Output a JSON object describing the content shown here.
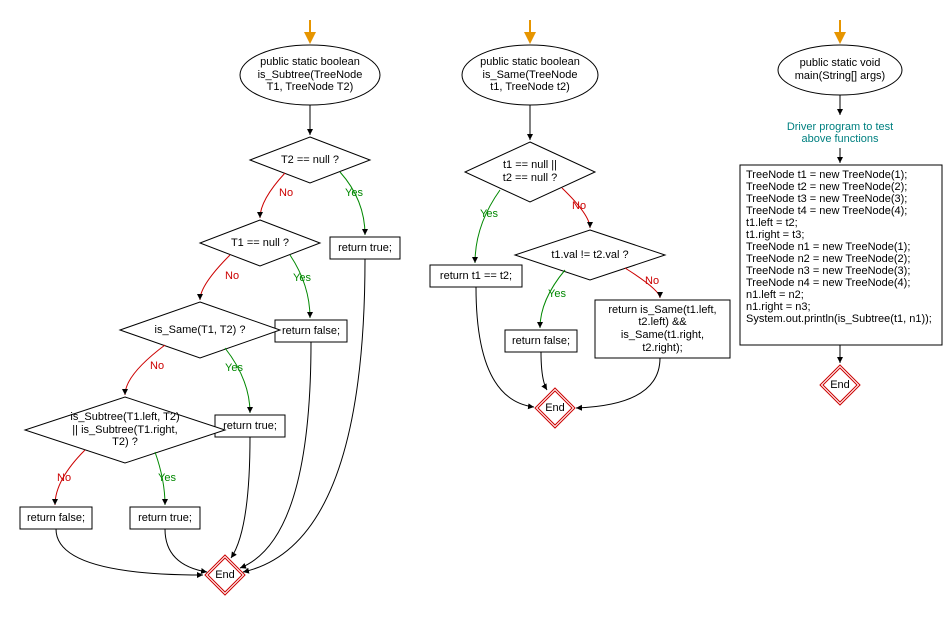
{
  "flow1": {
    "start": "public static boolean\nis_Subtree(TreeNode\nT1, TreeNode T2)",
    "d1": "T2 == null ?",
    "d2": "T1 == null ?",
    "d3": "is_Same(T1, T2) ?",
    "d4": "is_Subtree(T1.left, T2)\n|| is_Subtree(T1.right,\nT2) ?",
    "rTrue1": "return true;",
    "rFalse1": "return false;",
    "rTrue2": "return true;",
    "rFalse2": "return false;",
    "rTrue3": "return true;",
    "end": "End"
  },
  "flow2": {
    "start": "public static boolean\nis_Same(TreeNode\nt1, TreeNode t2)",
    "d1": "t1 == null ||\nt2 == null ?",
    "d2": "t1.val != t2.val ?",
    "r1": "return t1 == t2;",
    "rFalse": "return false;",
    "rRec": "return is_Same(t1.left,\nt2.left) &&\nis_Same(t1.right,\nt2.right);",
    "end": "End"
  },
  "flow3": {
    "start": "public static void\nmain(String[] args)",
    "comment": "Driver program to test\nabove functions",
    "code": "TreeNode t1 = new TreeNode(1);\nTreeNode t2 = new TreeNode(2);\nTreeNode t3 = new TreeNode(3);\nTreeNode t4 = new TreeNode(4);\nt1.left = t2;\nt1.right = t3;\nTreeNode n1 = new TreeNode(1);\nTreeNode n2 = new TreeNode(2);\nTreeNode n3 = new TreeNode(3);\nTreeNode n4 = new TreeNode(4);\nn1.left = n2;\nn1.right = n3;\nSystem.out.println(is_Subtree(t1, n1));",
    "end": "End"
  },
  "labels": {
    "yes": "Yes",
    "no": "No"
  }
}
